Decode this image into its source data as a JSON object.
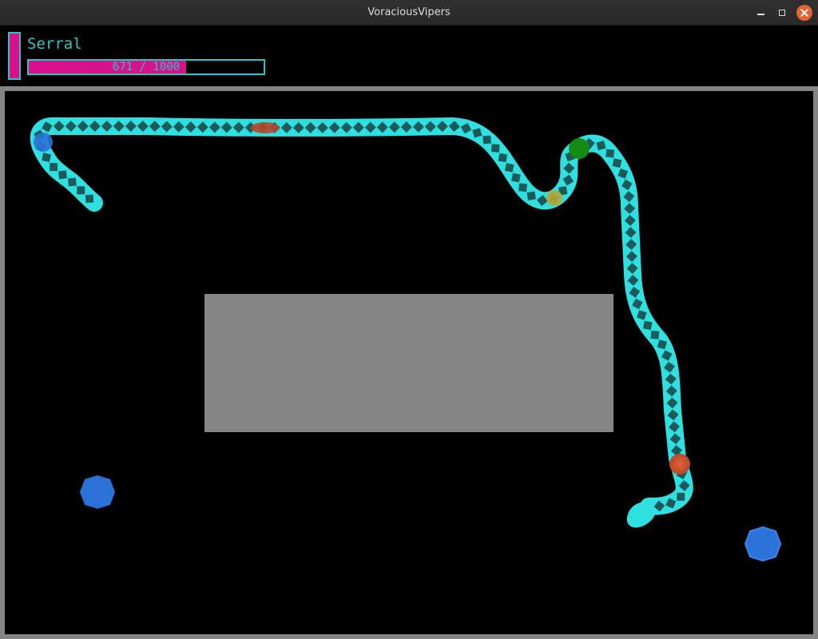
{
  "window": {
    "title": "VoraciousVipers"
  },
  "hud": {
    "player_name": "Serral",
    "health_text": "671 / 1000",
    "health_value": 671,
    "health_max": 1000
  },
  "colors": {
    "player_primary": "#d6138c",
    "player_secondary": "#2ec4c4",
    "arena_border": "#848484",
    "obstacle": "#858585",
    "food_blue": "#2a72d8",
    "snake_body": "#2ee0e0",
    "snake_diamond": "#1c5a5a"
  },
  "icons": {
    "minimize": "minimize-icon",
    "maximize": "maximize-icon",
    "close": "close-icon"
  }
}
